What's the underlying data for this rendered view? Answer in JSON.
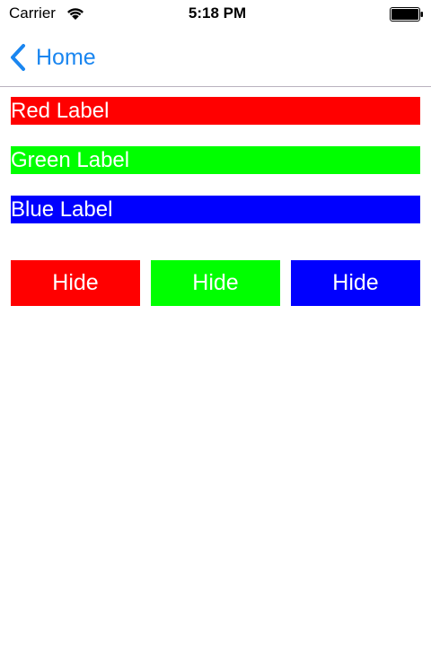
{
  "status_bar": {
    "carrier": "Carrier",
    "time": "5:18 PM",
    "icons": [
      "wifi-icon",
      "battery-icon"
    ]
  },
  "nav_bar": {
    "back_label": "Home",
    "back_icon": "chevron-left-icon",
    "accent_color": "#1a86f0"
  },
  "labels": [
    {
      "text": "Red Label",
      "color": "#ff0000"
    },
    {
      "text": "Green Label",
      "color": "#00ff00"
    },
    {
      "text": "Blue Label",
      "color": "#0000ff"
    }
  ],
  "buttons": [
    {
      "label": "Hide",
      "color": "#ff0000"
    },
    {
      "label": "Hide",
      "color": "#00ff00"
    },
    {
      "label": "Hide",
      "color": "#0000ff"
    }
  ]
}
